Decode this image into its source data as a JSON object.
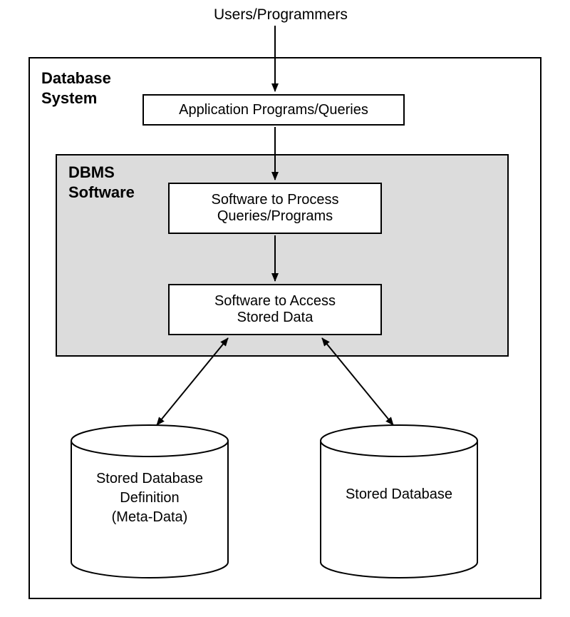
{
  "diagram": {
    "top_label": "Users/Programmers",
    "outer_box_label_line1": "Database",
    "outer_box_label_line2": "System",
    "inner_box_label_line1": "DBMS",
    "inner_box_label_line2": "Software",
    "node_app": "Application Programs/Queries",
    "node_process_line1": "Software to Process",
    "node_process_line2": "Queries/Programs",
    "node_access_line1": "Software to Access",
    "node_access_line2": "Stored Data",
    "cylinder_left_line1": "Stored Database",
    "cylinder_left_line2": "Definition",
    "cylinder_left_line3": "(Meta-Data)",
    "cylinder_right_line1": "Stored Database"
  }
}
